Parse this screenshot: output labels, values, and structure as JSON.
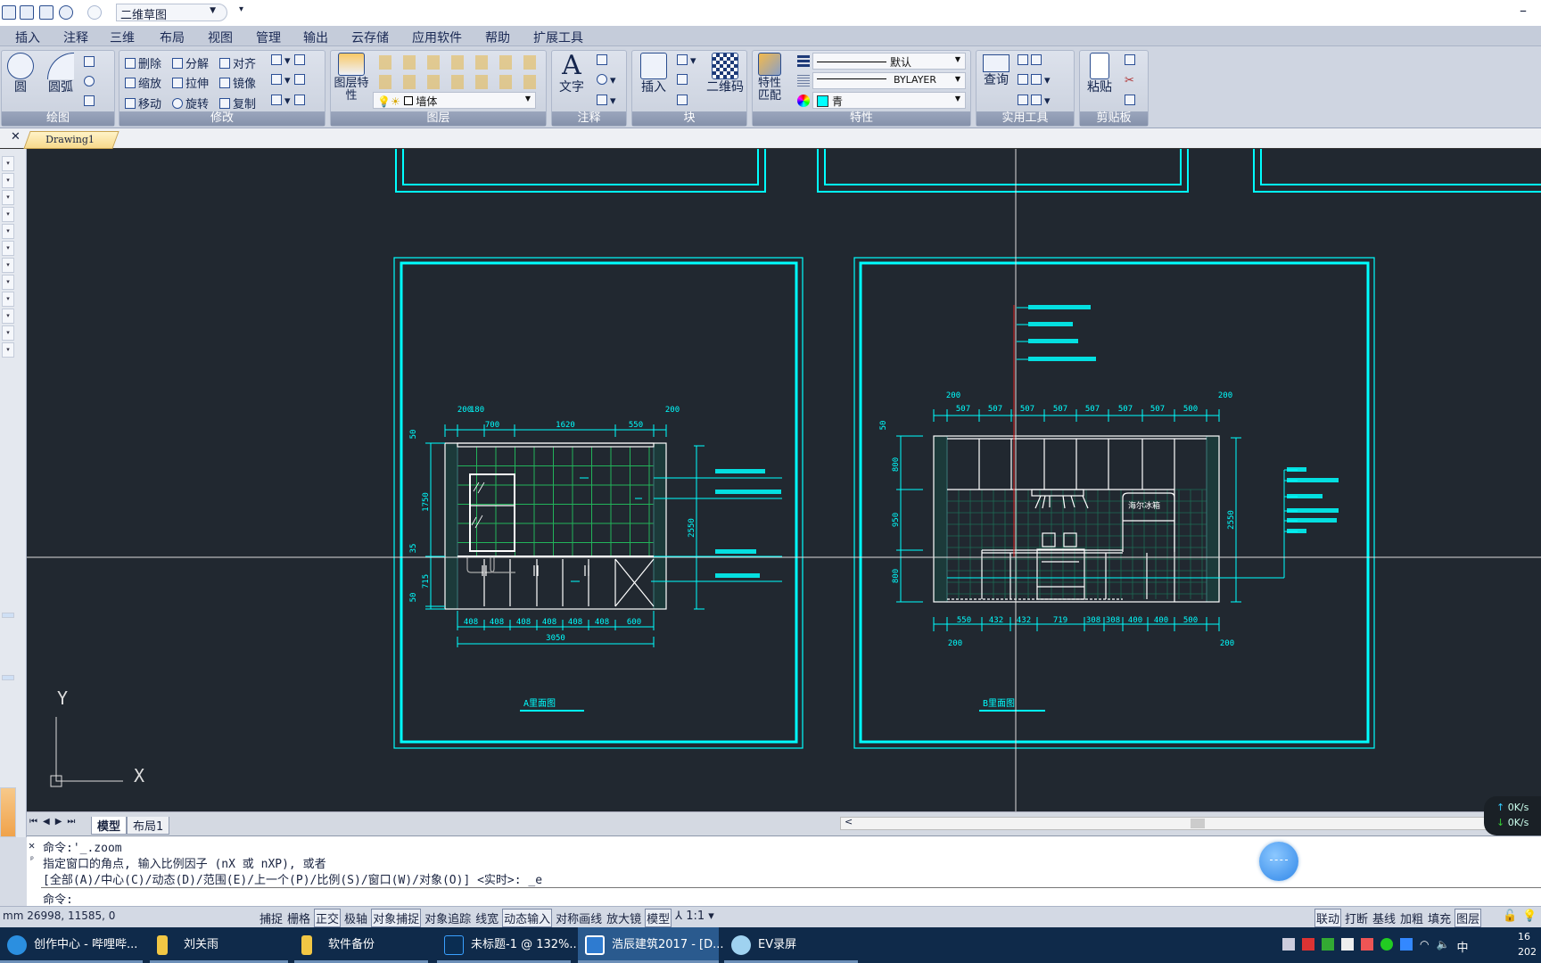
{
  "quick_access": {
    "workspace": "二维草图"
  },
  "menu": [
    "插入",
    "注释",
    "三维",
    "布局",
    "视图",
    "管理",
    "输出",
    "云存储",
    "应用软件",
    "帮助",
    "扩展工具"
  ],
  "ribbon": {
    "groups": [
      "绘图",
      "修改",
      "图层",
      "注释",
      "块",
      "特性",
      "实用工具",
      "剪贴板"
    ],
    "draw": {
      "circle": "圆",
      "arc": "圆弧"
    },
    "modify": [
      "删除",
      "分解",
      "对齐",
      "缩放",
      "拉伸",
      "镜像",
      "移动",
      "旋转",
      "复制"
    ],
    "layer": {
      "properties": "图层特性",
      "current": "墙体"
    },
    "annotate": {
      "text": "文字"
    },
    "block": {
      "insert": "插入",
      "qrcode": "二维码"
    },
    "properties": {
      "match": "特性匹配",
      "lineweight": "默认",
      "linetype": "BYLAYER",
      "color": "青",
      "color_hex": "#00ffff"
    },
    "utilities": {
      "query": "查询"
    },
    "clipboard": {
      "paste": "粘贴"
    }
  },
  "document_tab": "Drawing1",
  "drawing": {
    "a": {
      "title": "A里面图",
      "top_dims": [
        "200",
        "180",
        "700",
        "1620",
        "550",
        "200"
      ],
      "bottom_dims": [
        "408",
        "408",
        "408",
        "408",
        "408",
        "408",
        "600"
      ],
      "total": "3050",
      "left_dims": [
        "50",
        "1750",
        "35",
        "715",
        "50"
      ],
      "height": "2550"
    },
    "b": {
      "title": "B里面图",
      "top_dims": [
        "200",
        "507",
        "507",
        "507",
        "507",
        "507",
        "507",
        "507",
        "500",
        "200"
      ],
      "bottom_dims": [
        "550",
        "432",
        "432",
        "719",
        "308",
        "308",
        "400",
        "400",
        "500"
      ],
      "bottom_edges": [
        "200",
        "200"
      ],
      "left_dims": [
        "50",
        "800",
        "950",
        "800"
      ],
      "height": "2550",
      "fridge": "海尔冰箱"
    }
  },
  "ucs": {
    "x": "X",
    "y": "Y"
  },
  "layout_tabs": [
    "模型",
    "布局1"
  ],
  "command": {
    "history": [
      "命令:'_.zoom",
      "指定窗口的角点, 输入比例因子 (nX 或 nXP), 或者",
      "[全部(A)/中心(C)/动态(D)/范围(E)/上一个(P)/比例(S)/窗口(W)/对象(O)] <实时>: _e"
    ],
    "prompt": "命令:"
  },
  "status": {
    "coords": "mm 26998, 11585, 0",
    "toggles": [
      {
        "label": "捕捉",
        "on": false
      },
      {
        "label": "栅格",
        "on": false
      },
      {
        "label": "正交",
        "on": true
      },
      {
        "label": "极轴",
        "on": false
      },
      {
        "label": "对象捕捉",
        "on": true
      },
      {
        "label": "对象追踪",
        "on": false
      },
      {
        "label": "线宽",
        "on": false
      },
      {
        "label": "动态输入",
        "on": true
      },
      {
        "label": "对称画线",
        "on": false
      },
      {
        "label": "放大镜",
        "on": false
      },
      {
        "label": "模型",
        "on": true
      }
    ],
    "scale": "1:1",
    "right": [
      "联动",
      "打断",
      "基线",
      "加粗",
      "填充",
      "图层"
    ]
  },
  "network": {
    "up": "0K/s",
    "down": "0K/s"
  },
  "taskbar": {
    "items": [
      {
        "label": "创作中心 - 哔哩哔...",
        "color": "#2b8fe0"
      },
      {
        "label": "刘关雨",
        "color": "#f2c744"
      },
      {
        "label": "软件备份",
        "color": "#f2c744"
      },
      {
        "label": "未标题-1 @ 132%...",
        "color": "#0a2d52"
      },
      {
        "label": "浩辰建筑2017 - [D...",
        "color": "#2e7bd0",
        "active": true
      },
      {
        "label": "EV录屏",
        "color": "#9fd2f0"
      }
    ],
    "ime": "中",
    "clock": "16",
    "date": "202"
  }
}
